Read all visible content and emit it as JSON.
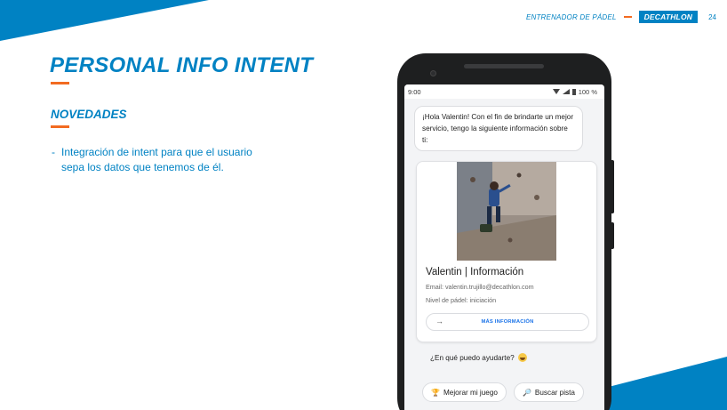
{
  "colors": {
    "primary": "#0082c3",
    "accent": "#f26b21",
    "phone_body": "#1e1f20"
  },
  "header": {
    "section_label": "ENTRENADOR DE PÁDEL",
    "brand": "DECATHLON",
    "page_number": "24"
  },
  "slide": {
    "title": "PERSONAL INFO INTENT",
    "subtitle": "NOVEDADES",
    "bullets": [
      {
        "marker": "-",
        "text": "Integración de intent para que el usuario sepa los datos que tenemos de él."
      }
    ]
  },
  "phone": {
    "status": {
      "time": "9:00",
      "battery": "100 %"
    },
    "greeting": "¡Hola Valentin! Con el fin de brindarte un mejor servicio, tengo la siguiente información sobre ti:",
    "card": {
      "title": "Valentin | Información",
      "email_line": "Email: valentin.trujillo@decathlon.com",
      "level_line": "Nivel de pádel: iniciación",
      "button_arrow": "→",
      "button_label": "MÁS INFORMACIÓN"
    },
    "question": "¿En qué puedo ayudarte?",
    "chips": [
      {
        "icon": "trophy-icon",
        "glyph": "🏆",
        "label": "Mejorar mi juego"
      },
      {
        "icon": "search-icon",
        "glyph": "🔎",
        "label": "Buscar pista"
      }
    ]
  }
}
